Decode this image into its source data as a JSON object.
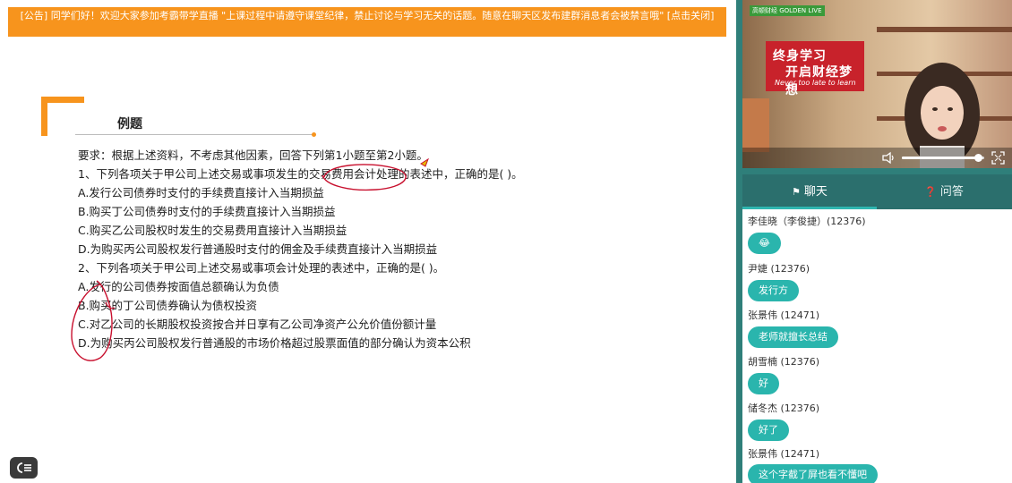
{
  "notice": {
    "text": "[公告] 同学们好！欢迎大家参加考霸带学直播 \"上课过程中请遵守课堂纪律，禁止讨论与学习无关的话题。随意在聊天区发布建群消息者会被禁言哦\" [点击关闭]"
  },
  "slide": {
    "example_title": "例题",
    "requirement": "要求：根据上述资料，不考虑其他因素，回答下列第1小题至第2小题。",
    "q1": "1、下列各项关于甲公司上述交易或事项发生的交易费用会计处理的表述中，正确的是(   )。",
    "q1_options": [
      "A.发行公司债券时支付的手续费直接计入当期损益",
      "B.购买丁公司债券时支付的手续费直接计入当期损益",
      "C.购买乙公司股权时发生的交易费用直接计入当期损益",
      "D.为购买丙公司股权发行普通股时支付的佣金及手续费直接计入当期损益"
    ],
    "q2": "2、下列各项关于甲公司上述交易或事项会计处理的表述中，正确的是(   )。",
    "q2_options": [
      "A.发行的公司债券按面值总额确认为负债",
      "B.购买的丁公司债券确认为债权投资",
      "C.对乙公司的长期股权投资按合并日享有乙公司净资产公允价值份额计量",
      "D.为购买丙公司股权发行普通股的市场价格超过股票面值的部分确认为资本公积"
    ]
  },
  "video": {
    "brand": "高顿财经 GOLDEN LIVE",
    "poster_line1": "终身学习",
    "poster_line2": "开启财经梦想",
    "poster_line3": "Never too late to learn",
    "volume_fraction": 0.92
  },
  "chat": {
    "tabs": [
      {
        "label": "聊天",
        "icon": "chat-icon",
        "active": true
      },
      {
        "label": "问答",
        "icon": "question-icon",
        "active": false
      }
    ],
    "messages": [
      {
        "sender": "李佳晓（李俊捷）(12376)",
        "text": "😂"
      },
      {
        "sender": "尹婕 (12376)",
        "text": "发行方"
      },
      {
        "sender": "张景伟 (12471)",
        "text": "老师就擅长总结"
      },
      {
        "sender": "胡雪楠 (12376)",
        "text": "好"
      },
      {
        "sender": "储冬杰 (12376)",
        "text": "好了"
      },
      {
        "sender": "张景伟 (12471)",
        "text": "这个字截了屏也看不懂吧"
      }
    ]
  },
  "colors": {
    "accent_orange": "#f7941d",
    "chat_bubble": "#2ab5ad",
    "tab_bar": "#2b6f6d",
    "frame": "#2f7f7a",
    "annotation_red": "#c8102e"
  }
}
